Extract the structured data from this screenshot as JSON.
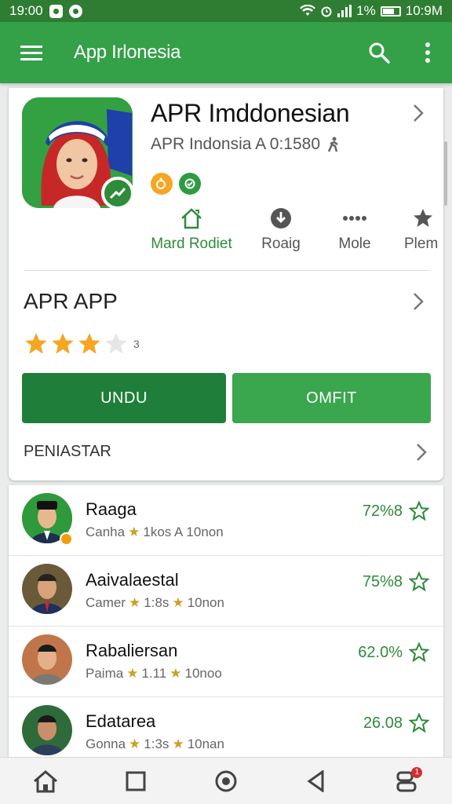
{
  "status_bar": {
    "left_time": "19:00",
    "battery_pct": "1%",
    "right_time": "10:9M"
  },
  "app_bar": {
    "title": "App Irlonesia"
  },
  "app": {
    "name": "APR Imddonesian",
    "subtitle": "APR Indonsia A 0:1580",
    "actions": [
      {
        "label": "Mard Rodiet",
        "icon": "home-icon",
        "color": "#2e8b3a"
      },
      {
        "label": "Roaig",
        "icon": "download-icon",
        "color": "#555555"
      },
      {
        "label": "Mole",
        "icon": "more-icon",
        "color": "#555555"
      },
      {
        "label": "Plem",
        "icon": "star-icon",
        "color": "#555555"
      }
    ]
  },
  "section": {
    "title": "APR APP",
    "rating": 3,
    "rating_count": "3",
    "primary_button": "UNDU",
    "secondary_button": "OMFIT",
    "link_row": "PENIASTAR"
  },
  "list": [
    {
      "name": "Raaga",
      "meta_left": "Canha",
      "meta_mid": "1kos A",
      "meta_right": "10non",
      "score": "72%8",
      "badge": true
    },
    {
      "name": "Aaivalaestal",
      "meta_left": "Camer",
      "meta_mid": "1:8s",
      "meta_right": "10non",
      "score": "75%8",
      "badge": false
    },
    {
      "name": "Rabaliersan",
      "meta_left": "Paima",
      "meta_mid": "1.11",
      "meta_right": "10noo",
      "score": "62.0%",
      "badge": false
    },
    {
      "name": "Edatarea",
      "meta_left": "Gonna",
      "meta_mid": "1:3s",
      "meta_right": "10nan",
      "score": "26.08",
      "badge": false
    }
  ],
  "nav": {
    "notification_count": "1"
  },
  "colors": {
    "primary": "#34a048",
    "status": "#2e7d32",
    "dark_button": "#1f7f3a",
    "star": "#f5a623"
  }
}
